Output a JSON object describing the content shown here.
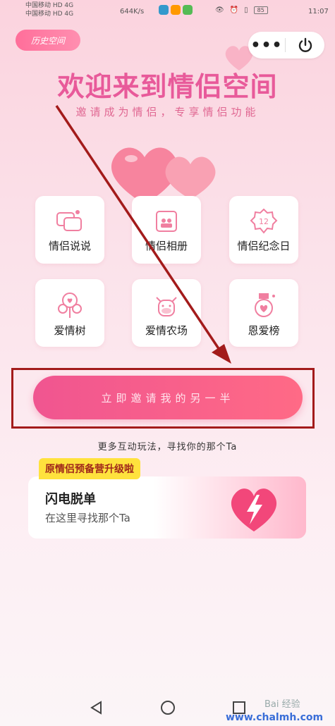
{
  "status_bar": {
    "carrier_line1": "中国移动 HD 4G",
    "carrier_line2": "中国移动 HD 4G",
    "net_speed": "644K/s",
    "battery": "85",
    "time": "11:07"
  },
  "header": {
    "history_label": "历史空间",
    "more_label": "•••"
  },
  "hero": {
    "title": "欢迎来到情侣空间",
    "subtitle": "邀请成为情侣，专享情侣功能"
  },
  "features": [
    {
      "label": "情侣说说",
      "icon": "chat-bubbles-icon"
    },
    {
      "label": "情侣相册",
      "icon": "photo-album-icon"
    },
    {
      "label": "情侣纪念日",
      "icon": "calendar-badge-icon"
    },
    {
      "label": "爱情树",
      "icon": "love-tree-icon"
    },
    {
      "label": "爱情农场",
      "icon": "farm-cow-icon"
    },
    {
      "label": "恩爱榜",
      "icon": "ranking-medal-icon"
    }
  ],
  "cta": {
    "label": "立即邀请我的另一半",
    "hint": "更多互动玩法，寻找你的那个Ta"
  },
  "promo": {
    "tag": "原情侣预备营升级啦",
    "title": "闪电脱单",
    "subtitle": "在这里寻找那个Ta"
  },
  "watermark": {
    "baidu": "Bai 经验",
    "site": "www.chalmh.com"
  },
  "colors": {
    "accent": "#f05590",
    "tag_bg": "#ffe23d",
    "annotation_red": "#a31b1b"
  }
}
